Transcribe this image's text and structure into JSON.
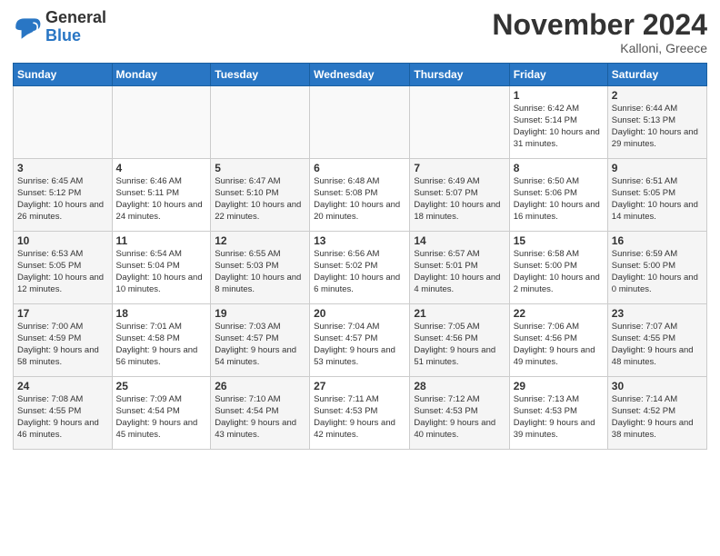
{
  "logo": {
    "general": "General",
    "blue": "Blue"
  },
  "header": {
    "month": "November 2024",
    "location": "Kalloni, Greece"
  },
  "weekdays": [
    "Sunday",
    "Monday",
    "Tuesday",
    "Wednesday",
    "Thursday",
    "Friday",
    "Saturday"
  ],
  "weeks": [
    [
      {
        "day": "",
        "sunrise": "",
        "sunset": "",
        "daylight": ""
      },
      {
        "day": "",
        "sunrise": "",
        "sunset": "",
        "daylight": ""
      },
      {
        "day": "",
        "sunrise": "",
        "sunset": "",
        "daylight": ""
      },
      {
        "day": "",
        "sunrise": "",
        "sunset": "",
        "daylight": ""
      },
      {
        "day": "",
        "sunrise": "",
        "sunset": "",
        "daylight": ""
      },
      {
        "day": "1",
        "sunrise": "Sunrise: 6:42 AM",
        "sunset": "Sunset: 5:14 PM",
        "daylight": "Daylight: 10 hours and 31 minutes."
      },
      {
        "day": "2",
        "sunrise": "Sunrise: 6:44 AM",
        "sunset": "Sunset: 5:13 PM",
        "daylight": "Daylight: 10 hours and 29 minutes."
      }
    ],
    [
      {
        "day": "3",
        "sunrise": "Sunrise: 6:45 AM",
        "sunset": "Sunset: 5:12 PM",
        "daylight": "Daylight: 10 hours and 26 minutes."
      },
      {
        "day": "4",
        "sunrise": "Sunrise: 6:46 AM",
        "sunset": "Sunset: 5:11 PM",
        "daylight": "Daylight: 10 hours and 24 minutes."
      },
      {
        "day": "5",
        "sunrise": "Sunrise: 6:47 AM",
        "sunset": "Sunset: 5:10 PM",
        "daylight": "Daylight: 10 hours and 22 minutes."
      },
      {
        "day": "6",
        "sunrise": "Sunrise: 6:48 AM",
        "sunset": "Sunset: 5:08 PM",
        "daylight": "Daylight: 10 hours and 20 minutes."
      },
      {
        "day": "7",
        "sunrise": "Sunrise: 6:49 AM",
        "sunset": "Sunset: 5:07 PM",
        "daylight": "Daylight: 10 hours and 18 minutes."
      },
      {
        "day": "8",
        "sunrise": "Sunrise: 6:50 AM",
        "sunset": "Sunset: 5:06 PM",
        "daylight": "Daylight: 10 hours and 16 minutes."
      },
      {
        "day": "9",
        "sunrise": "Sunrise: 6:51 AM",
        "sunset": "Sunset: 5:05 PM",
        "daylight": "Daylight: 10 hours and 14 minutes."
      }
    ],
    [
      {
        "day": "10",
        "sunrise": "Sunrise: 6:53 AM",
        "sunset": "Sunset: 5:05 PM",
        "daylight": "Daylight: 10 hours and 12 minutes."
      },
      {
        "day": "11",
        "sunrise": "Sunrise: 6:54 AM",
        "sunset": "Sunset: 5:04 PM",
        "daylight": "Daylight: 10 hours and 10 minutes."
      },
      {
        "day": "12",
        "sunrise": "Sunrise: 6:55 AM",
        "sunset": "Sunset: 5:03 PM",
        "daylight": "Daylight: 10 hours and 8 minutes."
      },
      {
        "day": "13",
        "sunrise": "Sunrise: 6:56 AM",
        "sunset": "Sunset: 5:02 PM",
        "daylight": "Daylight: 10 hours and 6 minutes."
      },
      {
        "day": "14",
        "sunrise": "Sunrise: 6:57 AM",
        "sunset": "Sunset: 5:01 PM",
        "daylight": "Daylight: 10 hours and 4 minutes."
      },
      {
        "day": "15",
        "sunrise": "Sunrise: 6:58 AM",
        "sunset": "Sunset: 5:00 PM",
        "daylight": "Daylight: 10 hours and 2 minutes."
      },
      {
        "day": "16",
        "sunrise": "Sunrise: 6:59 AM",
        "sunset": "Sunset: 5:00 PM",
        "daylight": "Daylight: 10 hours and 0 minutes."
      }
    ],
    [
      {
        "day": "17",
        "sunrise": "Sunrise: 7:00 AM",
        "sunset": "Sunset: 4:59 PM",
        "daylight": "Daylight: 9 hours and 58 minutes."
      },
      {
        "day": "18",
        "sunrise": "Sunrise: 7:01 AM",
        "sunset": "Sunset: 4:58 PM",
        "daylight": "Daylight: 9 hours and 56 minutes."
      },
      {
        "day": "19",
        "sunrise": "Sunrise: 7:03 AM",
        "sunset": "Sunset: 4:57 PM",
        "daylight": "Daylight: 9 hours and 54 minutes."
      },
      {
        "day": "20",
        "sunrise": "Sunrise: 7:04 AM",
        "sunset": "Sunset: 4:57 PM",
        "daylight": "Daylight: 9 hours and 53 minutes."
      },
      {
        "day": "21",
        "sunrise": "Sunrise: 7:05 AM",
        "sunset": "Sunset: 4:56 PM",
        "daylight": "Daylight: 9 hours and 51 minutes."
      },
      {
        "day": "22",
        "sunrise": "Sunrise: 7:06 AM",
        "sunset": "Sunset: 4:56 PM",
        "daylight": "Daylight: 9 hours and 49 minutes."
      },
      {
        "day": "23",
        "sunrise": "Sunrise: 7:07 AM",
        "sunset": "Sunset: 4:55 PM",
        "daylight": "Daylight: 9 hours and 48 minutes."
      }
    ],
    [
      {
        "day": "24",
        "sunrise": "Sunrise: 7:08 AM",
        "sunset": "Sunset: 4:55 PM",
        "daylight": "Daylight: 9 hours and 46 minutes."
      },
      {
        "day": "25",
        "sunrise": "Sunrise: 7:09 AM",
        "sunset": "Sunset: 4:54 PM",
        "daylight": "Daylight: 9 hours and 45 minutes."
      },
      {
        "day": "26",
        "sunrise": "Sunrise: 7:10 AM",
        "sunset": "Sunset: 4:54 PM",
        "daylight": "Daylight: 9 hours and 43 minutes."
      },
      {
        "day": "27",
        "sunrise": "Sunrise: 7:11 AM",
        "sunset": "Sunset: 4:53 PM",
        "daylight": "Daylight: 9 hours and 42 minutes."
      },
      {
        "day": "28",
        "sunrise": "Sunrise: 7:12 AM",
        "sunset": "Sunset: 4:53 PM",
        "daylight": "Daylight: 9 hours and 40 minutes."
      },
      {
        "day": "29",
        "sunrise": "Sunrise: 7:13 AM",
        "sunset": "Sunset: 4:53 PM",
        "daylight": "Daylight: 9 hours and 39 minutes."
      },
      {
        "day": "30",
        "sunrise": "Sunrise: 7:14 AM",
        "sunset": "Sunset: 4:52 PM",
        "daylight": "Daylight: 9 hours and 38 minutes."
      }
    ]
  ]
}
